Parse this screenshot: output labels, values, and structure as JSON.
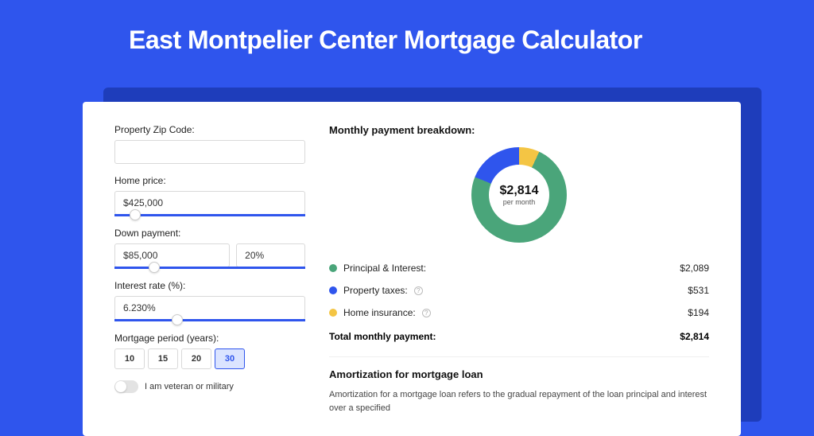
{
  "title": "East Montpelier Center Mortgage Calculator",
  "form": {
    "zip_label": "Property Zip Code:",
    "zip_value": "",
    "home_price_label": "Home price:",
    "home_price_value": "$425,000",
    "down_payment_label": "Down payment:",
    "down_payment_value": "$85,000",
    "down_payment_pct": "20%",
    "interest_label": "Interest rate (%):",
    "interest_value": "6.230%",
    "period_label": "Mortgage period (years):",
    "periods": [
      "10",
      "15",
      "20",
      "30"
    ],
    "period_selected": "30",
    "veteran_label": "I am veteran or military"
  },
  "breakdown": {
    "title": "Monthly payment breakdown:",
    "donut_amount": "$2,814",
    "donut_sub": "per month",
    "items": [
      {
        "label": "Principal & Interest:",
        "value": "$2,089",
        "color": "green",
        "info": false
      },
      {
        "label": "Property taxes:",
        "value": "$531",
        "color": "blue",
        "info": true
      },
      {
        "label": "Home insurance:",
        "value": "$194",
        "color": "yellow",
        "info": true
      }
    ],
    "total_label": "Total monthly payment:",
    "total_value": "$2,814"
  },
  "amortization": {
    "title": "Amortization for mortgage loan",
    "text": "Amortization for a mortgage loan refers to the gradual repayment of the loan principal and interest over a specified"
  },
  "chart_data": {
    "type": "pie",
    "title": "Monthly payment breakdown",
    "series": [
      {
        "name": "Principal & Interest",
        "value": 2089
      },
      {
        "name": "Property taxes",
        "value": 531
      },
      {
        "name": "Home insurance",
        "value": 194
      }
    ],
    "total": 2814
  }
}
